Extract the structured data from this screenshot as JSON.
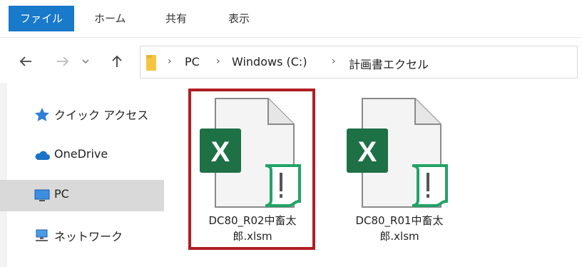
{
  "ribbon": {
    "tabs": [
      "ファイル",
      "ホーム",
      "共有",
      "表示"
    ]
  },
  "address": {
    "crumbs": [
      "PC",
      "Windows (C:)",
      "計画書エクセル"
    ]
  },
  "sidebar": {
    "items": [
      {
        "label": "クイック アクセス",
        "icon": "star-icon"
      },
      {
        "label": "OneDrive",
        "icon": "cloud-icon"
      },
      {
        "label": "PC",
        "icon": "monitor-icon",
        "selected": true
      },
      {
        "label": "ネットワーク",
        "icon": "network-icon"
      }
    ]
  },
  "files": [
    {
      "name_line1": "DC80_R02中畜太",
      "name_line2": "郎.xlsm",
      "icon": "excel-macro-file-icon",
      "selected": true
    },
    {
      "name_line1": "DC80_R01中畜太",
      "name_line2": "郎.xlsm",
      "icon": "excel-macro-file-icon",
      "selected": false
    }
  ],
  "colors": {
    "file_tab": "#1979ca",
    "excel_green": "#1e7145",
    "highlight_border": "#b01e24",
    "folder_yellow": "#f5c542"
  }
}
